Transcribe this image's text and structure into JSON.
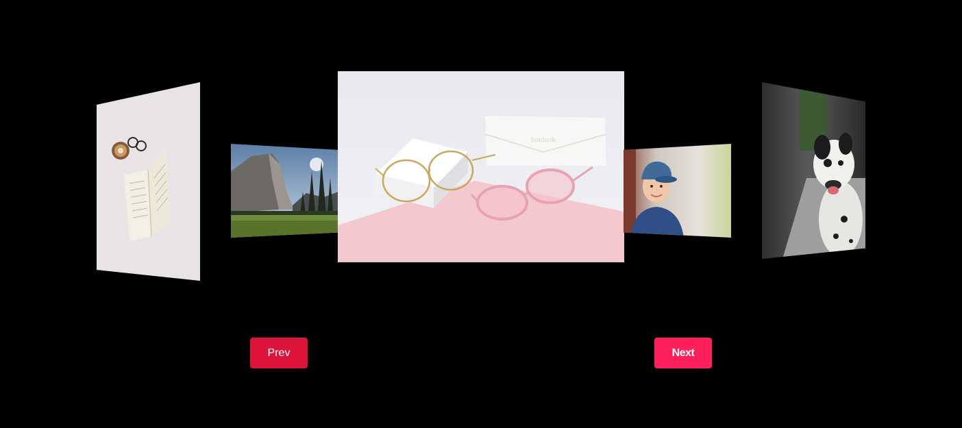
{
  "carousel": {
    "slides": [
      {
        "id": "book-coffee",
        "subject": "open book with coffee and glasses"
      },
      {
        "id": "mountain",
        "subject": "granite cliff and pine meadow"
      },
      {
        "id": "glasses",
        "subject": "two pairs of eyeglasses with case"
      },
      {
        "id": "boy",
        "subject": "smiling boy in blue cap"
      },
      {
        "id": "dog",
        "subject": "dalmatian-spotted dog on sidewalk"
      }
    ],
    "active_index": 2,
    "case_text": "bonlook"
  },
  "controls": {
    "prev_label": "Prev",
    "next_label": "Next",
    "prev_color": "#dc143c",
    "next_color": "#ff1f5a"
  },
  "colors": {
    "background": "#000000"
  }
}
